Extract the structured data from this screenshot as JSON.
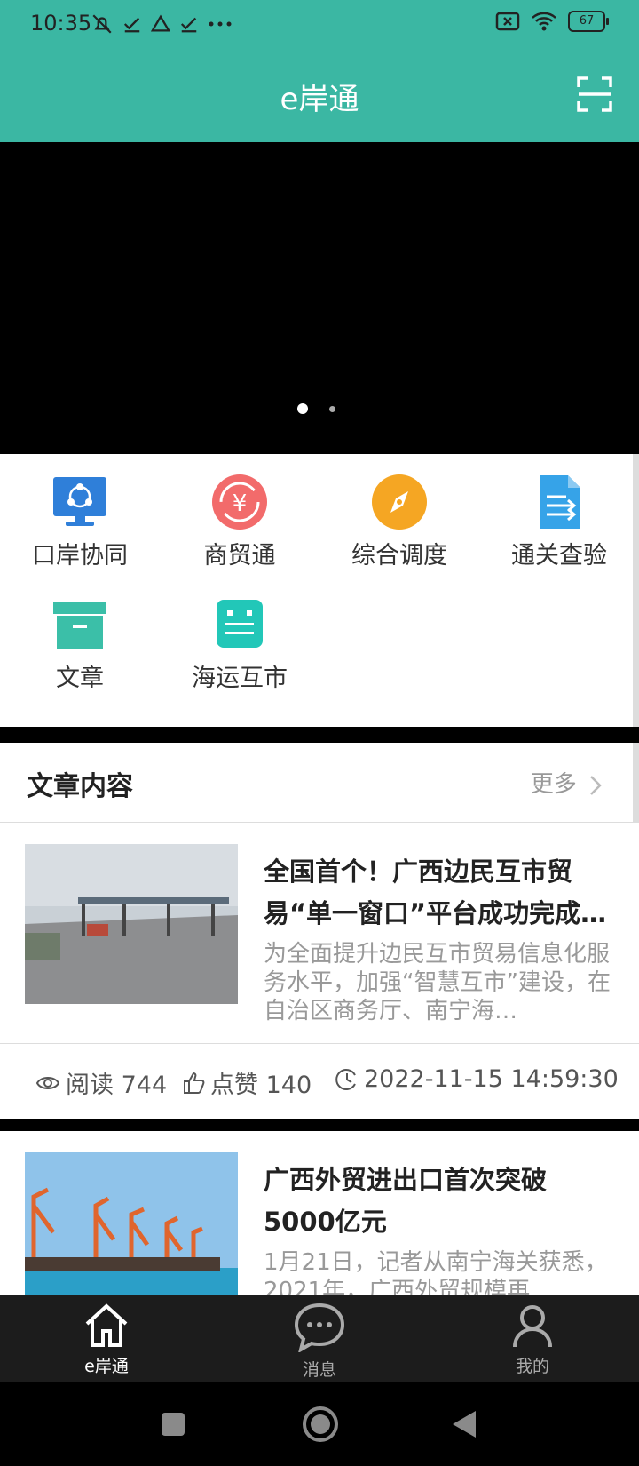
{
  "status": {
    "time": "10:35",
    "battery": "67"
  },
  "header": {
    "title": "e岸通"
  },
  "grid": [
    {
      "label": "口岸协同",
      "icon": "monitor-network-icon"
    },
    {
      "label": "商贸通",
      "icon": "yen-exchange-icon"
    },
    {
      "label": "综合调度",
      "icon": "compass-icon"
    },
    {
      "label": "通关查验",
      "icon": "document-arrow-icon"
    },
    {
      "label": "文章",
      "icon": "archive-box-icon"
    },
    {
      "label": "海运互市",
      "icon": "chat-list-icon"
    }
  ],
  "section": {
    "title": "文章内容",
    "more": "更多"
  },
  "articles": [
    {
      "title": "全国首个！广西边民互市贸易“单一窗口”平台成功完成…",
      "excerpt": "为全面提升边民互市贸易信息化服务水平，加强“智慧互市”建设，在自治区商务厅、南宁海…",
      "reads": "阅读 744",
      "likes": "点赞 140",
      "time": "2022-11-15 14:59:30"
    },
    {
      "title": "广西外贸进出口首次突破5000亿元",
      "excerpt": "1月21日，记者从南宁海关获悉，2021年，广西外贸规模再"
    }
  ],
  "tabs": [
    {
      "label": "e岸通",
      "icon": "home-icon",
      "active": true
    },
    {
      "label": "消息",
      "icon": "message-icon",
      "active": false
    },
    {
      "label": "我的",
      "icon": "user-icon",
      "active": false
    }
  ]
}
